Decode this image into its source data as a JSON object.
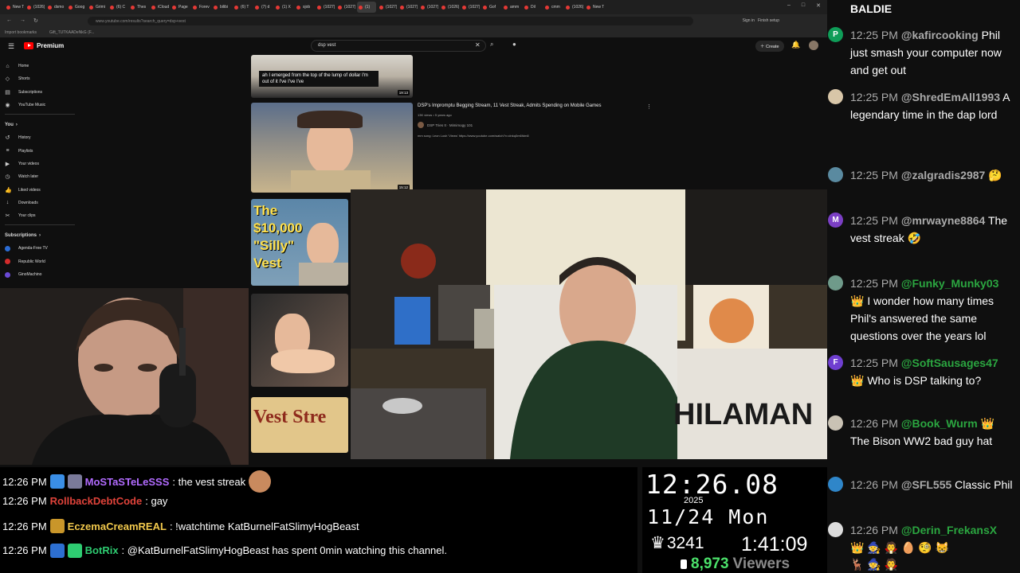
{
  "browser": {
    "tabs": [
      "New T",
      "(1026)",
      "dsmo",
      "Goog",
      "Grimi",
      "(6) C",
      "Thes",
      "iCloud",
      "Page",
      "Forev",
      "bilibi",
      "(6) T",
      "(7) d",
      "(1) X",
      "sjob",
      "(1027)",
      "(1027)",
      "(1)",
      "(1027)",
      "(1027)",
      "(1027)",
      "(1026)",
      "(1027)",
      "Gof",
      "amm",
      "Dil",
      "cmm",
      "(1026)",
      "New T"
    ],
    "url": "www.youtube.com/results?search_query=dsp+vest",
    "bookmarks": [
      "Import bookmarks",
      "Gift_TUTKAADeNkG (F..."
    ],
    "signin": "Sign in",
    "finish_setup": "Finish setup"
  },
  "youtube": {
    "logo_text": "Premium",
    "search_query": "dsp vest",
    "create_label": "Create",
    "sidebar_top": [
      {
        "icon": "⌂",
        "label": "Home"
      },
      {
        "icon": "◇",
        "label": "Shorts"
      },
      {
        "icon": "▤",
        "label": "Subscriptions"
      },
      {
        "icon": "◉",
        "label": "YouTube Music"
      }
    ],
    "you_heading": "You",
    "sidebar_you": [
      {
        "icon": "↺",
        "label": "History"
      },
      {
        "icon": "≡",
        "label": "Playlists"
      },
      {
        "icon": "▶",
        "label": "Your videos"
      },
      {
        "icon": "◷",
        "label": "Watch later"
      },
      {
        "icon": "👍",
        "label": "Liked videos"
      },
      {
        "icon": "↓",
        "label": "Downloads"
      },
      {
        "icon": "✂",
        "label": "Your clips"
      }
    ],
    "subs_heading": "Subscriptions",
    "sidebar_subs": [
      {
        "label": "Agenda-Free TV",
        "color": "#2b6cd4"
      },
      {
        "label": "Republic World",
        "color": "#d42b2b"
      },
      {
        "label": "GinoMachino",
        "color": "#6a4ad4"
      }
    ],
    "result1_caption": "ah I emerged from the top of the lump of dollar I'm out of it I've I've I've",
    "result1_duration": "19:13",
    "result2": {
      "title": "DSP's Impromptu Begging Stream, 11 Vest Streak, Admits Spending on Mobile Games",
      "meta": "13K views • 5 years ago",
      "channel": "DSP Tries It · Mimimogy 101",
      "desc": "mm song: Leon Lush 'Views' https://www.youtube.com/watch?v=dnkq0m6fdm8",
      "duration": "15:12"
    },
    "result3_text": "The $10,000 \"Silly\" Vest",
    "result5_text": "Vest Stre"
  },
  "overlay_chat": [
    {
      "time": "12:26 PM",
      "user": "MoSTaSTeLeSSS",
      "user_color": "#b26bff",
      "badges": [
        "#3a8ee6",
        "#7a7a9a"
      ],
      "text": ": the vest streak",
      "emote": true
    },
    {
      "time": "12:26 PM",
      "user": "RollbackDebtCode",
      "user_color": "#e0433a",
      "badges": [],
      "text": ": gay",
      "emote": false
    },
    {
      "time": "12:26 PM",
      "user": "EczemaCreamREAL",
      "user_color": "#f2c94c",
      "badges": [
        "#c9962a"
      ],
      "text": ": !watchtime KatBurnelFatSlimyHogBeast",
      "emote": false
    },
    {
      "time": "12:26 PM",
      "user": "BotRix",
      "user_color": "#2ecc71",
      "badges": [
        "#2d6fd1",
        "#2ecc71"
      ],
      "text": ": @KatBurnelFatSlimyHogBeast has spent 0min watching this channel.",
      "emote": false
    }
  ],
  "clock": {
    "time": "12:26.08",
    "year": "2025",
    "date": "11/24 Mon",
    "subs": "3241",
    "uptime": "1:41:09",
    "viewers_count": "8,973",
    "viewers_label": "Viewers"
  },
  "chat": [
    {
      "top_name": "BALDIE"
    },
    {
      "avatar": "P",
      "avatar_color": "#0f9d58",
      "time": "12:25 PM",
      "name": "@kafircooking",
      "green": false,
      "badge": "",
      "text": "Phil just smash your computer now and get out"
    },
    {
      "avatar": "",
      "avatar_color": "#d8c6a8",
      "time": "12:25 PM",
      "name": "@ShredEmAll1993",
      "green": false,
      "badge": "",
      "text": "A legendary time in the dap lord"
    },
    {
      "avatar": "",
      "avatar_color": "#5a8aa0",
      "time": "12:25 PM",
      "name": "@zalgradis2987",
      "green": false,
      "badge": "",
      "text": "🤔"
    },
    {
      "avatar": "M",
      "avatar_color": "#7b3fc4",
      "time": "12:25 PM",
      "name": "@mrwayne8864",
      "green": false,
      "badge": "",
      "text": "The vest streak 🤣"
    },
    {
      "avatar": "",
      "avatar_color": "#6f9a8a",
      "time": "12:25 PM",
      "name": "@Funky_Munky03",
      "green": true,
      "badge": "👑",
      "text": "I wonder how many times Phil's answered the same questions over the years lol"
    },
    {
      "avatar": "F",
      "avatar_color": "#6f3fd0",
      "time": "12:25 PM",
      "name": "@SoftSausages47",
      "green": true,
      "badge": "👑",
      "text": "Who is DSP talking to?"
    },
    {
      "avatar": "",
      "avatar_color": "#c9c2b4",
      "time": "12:26 PM",
      "name": "@Book_Wurm",
      "green": true,
      "badge": "👑",
      "text": "The Bison WW2 bad guy hat"
    },
    {
      "avatar": "",
      "avatar_color": "#2f86c9",
      "time": "12:26 PM",
      "name": "@SFL555",
      "green": false,
      "badge": "",
      "text": "Classic Phil"
    },
    {
      "avatar": "",
      "avatar_color": "#ddd",
      "time": "12:26 PM",
      "name": "@Derin_FrekansX",
      "green": true,
      "badge": "",
      "text": "👑 🧙 🧛 🥚 🧐 😸"
    },
    {
      "avatar": "",
      "avatar_color": "",
      "time": "",
      "name": "",
      "green": false,
      "badge": "",
      "text": "🦌 🧙 🧛"
    }
  ]
}
